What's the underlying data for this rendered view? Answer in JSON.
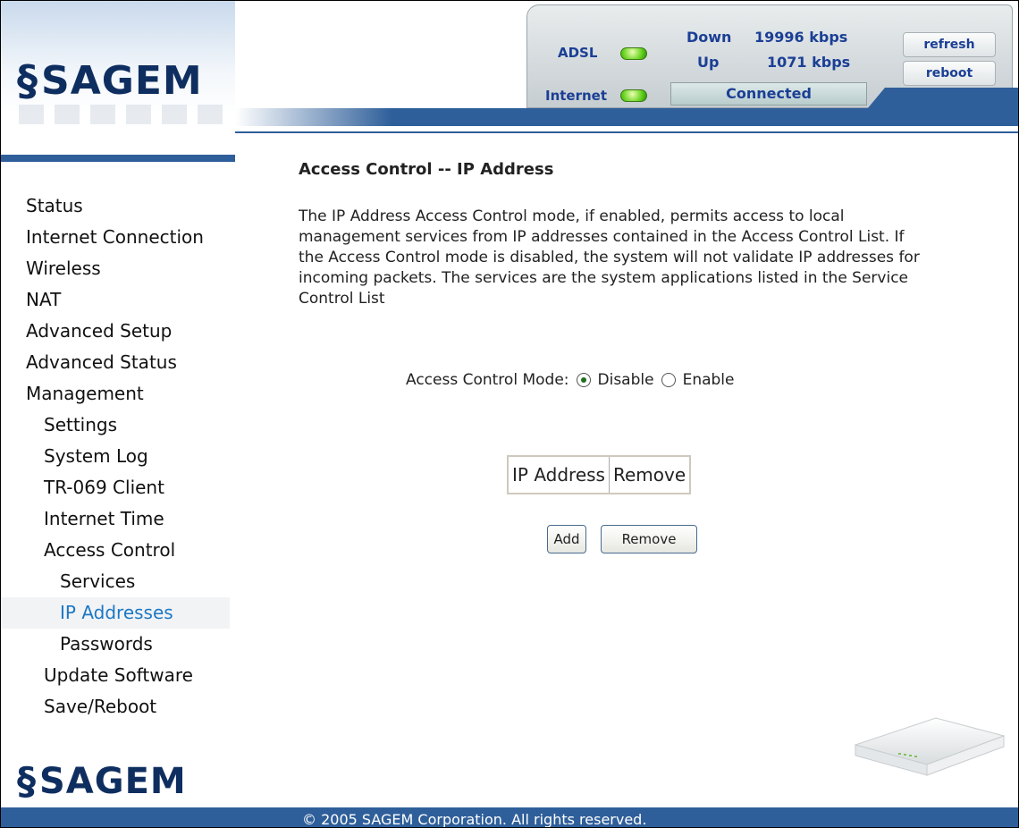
{
  "brand": {
    "name": "SAGEM"
  },
  "status": {
    "adsl_label": "ADSL",
    "internet_label": "Internet",
    "down_label": "Down",
    "down_value": "19996 kbps",
    "up_label": "Up",
    "up_value": "1071 kbps",
    "connection": "Connected",
    "refresh_label": "refresh",
    "reboot_label": "reboot",
    "led_color": "#5cc81a"
  },
  "sidebar": {
    "items": [
      {
        "label": "Status"
      },
      {
        "label": "Internet Connection"
      },
      {
        "label": "Wireless"
      },
      {
        "label": "NAT"
      },
      {
        "label": "Advanced Setup"
      },
      {
        "label": "Advanced Status"
      },
      {
        "label": "Management"
      },
      {
        "label": "Settings"
      },
      {
        "label": "System Log"
      },
      {
        "label": "TR-069 Client"
      },
      {
        "label": "Internet Time"
      },
      {
        "label": "Access Control"
      },
      {
        "label": "Services"
      },
      {
        "label": "IP Addresses"
      },
      {
        "label": "Passwords"
      },
      {
        "label": "Update Software"
      },
      {
        "label": "Save/Reboot"
      }
    ]
  },
  "main": {
    "title": "Access Control -- IP Address",
    "description": "The IP Address Access Control mode, if enabled, permits access to local management services from IP addresses contained in the Access Control List. If the Access Control mode is disabled, the system will not validate IP addresses for incoming packets. The services are the system applications listed in the Service Control List",
    "mode_label": "Access Control Mode:",
    "mode_options": [
      "Disable",
      "Enable"
    ],
    "mode_selected": "Disable",
    "table": {
      "columns": [
        "IP Address",
        "Remove"
      ]
    },
    "add_label": "Add",
    "remove_label": "Remove"
  },
  "footer": {
    "copyright": "© 2005 SAGEM Corporation. All rights reserved."
  },
  "colors": {
    "brand_blue": "#2f5f9a",
    "link_active": "#1c78c4",
    "status_text": "#1b3f95"
  }
}
